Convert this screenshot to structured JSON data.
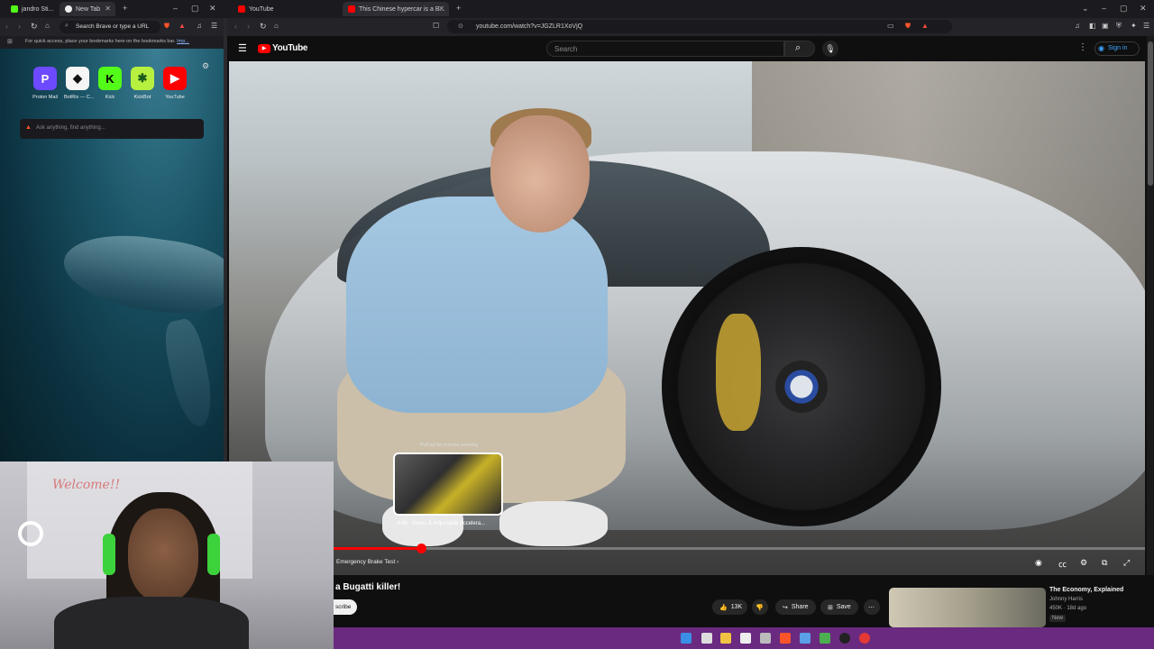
{
  "tabs_left": [
    {
      "label": "jandro Sti...",
      "color": "#53fc18"
    },
    {
      "label": "New Tab",
      "color": "#f1f1f1"
    }
  ],
  "tabs_right": [
    {
      "label": "YouTube",
      "color": "#ff0000"
    },
    {
      "label": "This Chinese hypercar is a B...",
      "color": "#ff0000"
    }
  ],
  "left_browser": {
    "address_placeholder": "Search Brave or type a URL",
    "bookmarks_hint": "For quick access, place your bookmarks here on the bookmarks bar.",
    "bookmarks_link": "Imp...",
    "shortcuts": [
      {
        "label": "Proton Mail",
        "glyph": "P",
        "bg": "#6d4aff",
        "fg": "#fff"
      },
      {
        "label": "BotRix — C...",
        "glyph": "◆",
        "bg": "#f5f5f5",
        "fg": "#111"
      },
      {
        "label": "Kick",
        "glyph": "K",
        "bg": "#53fc18",
        "fg": "#000"
      },
      {
        "label": "KickBot",
        "glyph": "✱",
        "bg": "#b8f040",
        "fg": "#1a5a1a"
      },
      {
        "label": "YouTube",
        "glyph": "▶",
        "bg": "#ff0000",
        "fg": "#fff"
      }
    ],
    "ask_placeholder": "Ask anything, find anything..."
  },
  "right_browser": {
    "url": "youtube.com/watch?v=JGZLR1XoVjQ"
  },
  "youtube": {
    "logo_text": "YouTube",
    "search_placeholder": "Search",
    "signin_label": "Sign in"
  },
  "player": {
    "preview_hint": "Pull up for precise seeking",
    "preview_label": "4:48 · Gears & Adjustable Accelera...",
    "chapter_label": "Emergency Brake Test",
    "progress_fraction": 0.108
  },
  "video_info": {
    "title": "a Bugatti killer!",
    "subscribe_label": "scribe",
    "likes": "13K",
    "share_label": "Share",
    "save_label": "Save"
  },
  "recommendation": {
    "title": "The Economy, Explained",
    "channel": "Johnny Harris",
    "meta": "450K · 18d ago",
    "badge": "New"
  },
  "webcam": {
    "whiteboard_text": "Welcome!!"
  },
  "colors": {
    "youtube_red": "#ff0000",
    "taskbar": "#6a2a80",
    "link_blue": "#3ea6ff"
  }
}
